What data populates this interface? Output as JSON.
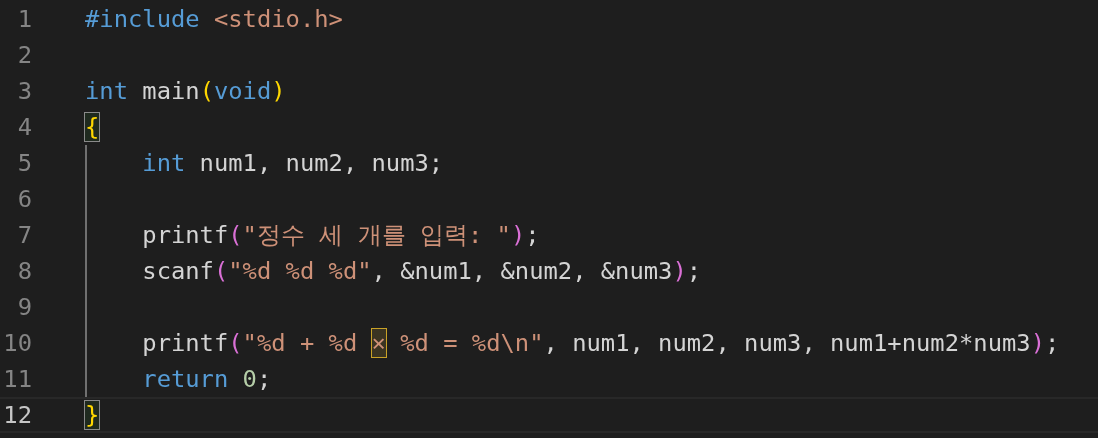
{
  "editor": {
    "lines": [
      {
        "number": "1",
        "current": false,
        "indent_guide": false,
        "tokens": [
          {
            "kind": "preprocessor",
            "text": "#include"
          },
          {
            "kind": "string",
            "text": " <stdio.h>"
          }
        ]
      },
      {
        "number": "2",
        "current": false,
        "indent_guide": false
      },
      {
        "number": "3",
        "current": false,
        "indent_guide": false,
        "tokens": [
          {
            "kind": "keyword",
            "text": "int"
          },
          {
            "kind": "plain",
            "text": " main"
          },
          {
            "kind": "bracket1",
            "text": "("
          },
          {
            "kind": "keyword",
            "text": "void"
          },
          {
            "kind": "bracket1",
            "text": ")"
          }
        ]
      },
      {
        "number": "4",
        "current": false,
        "indent_guide": false,
        "tokens": [
          {
            "kind": "bracket1",
            "text": "{",
            "matched": true
          }
        ]
      },
      {
        "number": "5",
        "current": false,
        "indent_guide": true,
        "tokens": [
          {
            "kind": "keyword",
            "text": "    int"
          },
          {
            "kind": "plain",
            "text": " num1, num2, num3;"
          }
        ]
      },
      {
        "number": "6",
        "current": false,
        "indent_guide": true
      },
      {
        "number": "7",
        "current": false,
        "indent_guide": true,
        "tokens": [
          {
            "kind": "plain",
            "text": "    printf"
          },
          {
            "kind": "bracket2",
            "text": "("
          },
          {
            "kind": "string",
            "text": "\"정수 세 개를 입력: \""
          },
          {
            "kind": "bracket2",
            "text": ")"
          },
          {
            "kind": "plain",
            "text": ";"
          }
        ]
      },
      {
        "number": "8",
        "current": false,
        "indent_guide": true,
        "tokens": [
          {
            "kind": "plain",
            "text": "    scanf"
          },
          {
            "kind": "bracket2",
            "text": "("
          },
          {
            "kind": "string",
            "text": "\"%d %d %d\""
          },
          {
            "kind": "plain",
            "text": ", &num1, &num2, &num3"
          },
          {
            "kind": "bracket2",
            "text": ")"
          },
          {
            "kind": "plain",
            "text": ";"
          }
        ]
      },
      {
        "number": "9",
        "current": false,
        "indent_guide": true
      },
      {
        "number": "10",
        "current": false,
        "indent_guide": true,
        "tokens": [
          {
            "kind": "plain",
            "text": "    printf"
          },
          {
            "kind": "bracket2",
            "text": "("
          },
          {
            "kind": "string",
            "text": "\"%d + %d"
          },
          {
            "kind": "string",
            "text": "×",
            "highlighted": true
          },
          {
            "kind": "string",
            "text": "%d = %d\\n\""
          },
          {
            "kind": "plain",
            "text": ", num1, num2, num3, num1+num2*num3"
          },
          {
            "kind": "bracket2",
            "text": ")"
          },
          {
            "kind": "plain",
            "text": ";"
          }
        ]
      },
      {
        "number": "11",
        "current": false,
        "indent_guide": true,
        "tokens": [
          {
            "kind": "keyword",
            "text": "    return"
          },
          {
            "kind": "number",
            "text": " 0"
          },
          {
            "kind": "plain",
            "text": ";"
          }
        ]
      },
      {
        "number": "12",
        "current": true,
        "indent_guide": false,
        "tokens": [
          {
            "kind": "bracket1",
            "text": "}",
            "matched": true
          }
        ]
      }
    ]
  }
}
